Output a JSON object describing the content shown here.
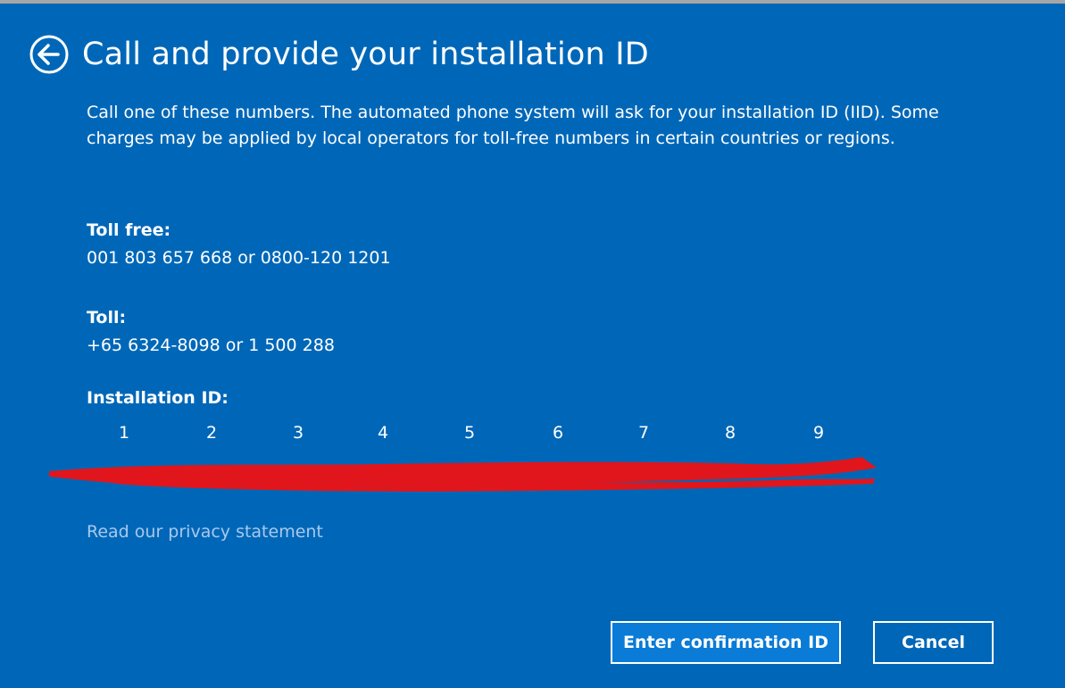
{
  "header": {
    "back_icon": "back-arrow-circle-icon",
    "title": "Call and provide your installation ID"
  },
  "description": "Call one of these numbers. The automated phone system will ask for your installation ID (IID). Some charges may be applied by local operators for toll-free numbers in certain countries or regions.",
  "toll_free": {
    "label": "Toll free:",
    "value": "001 803 657 668 or 0800-120 1201"
  },
  "toll": {
    "label": "Toll:",
    "value": "+65 6324-8098 or 1 500 288"
  },
  "installation_id": {
    "label": "Installation ID:",
    "columns": [
      "1",
      "2",
      "3",
      "4",
      "5",
      "6",
      "7",
      "8",
      "9"
    ],
    "redaction_color": "#e0161c"
  },
  "privacy_link": "Read our privacy statement",
  "buttons": {
    "primary_label": "Enter confirmation ID",
    "cancel_label": "Cancel"
  },
  "colors": {
    "background": "#0067b8",
    "primary_button": "#0a7bd6",
    "link": "#a8c9ec"
  }
}
